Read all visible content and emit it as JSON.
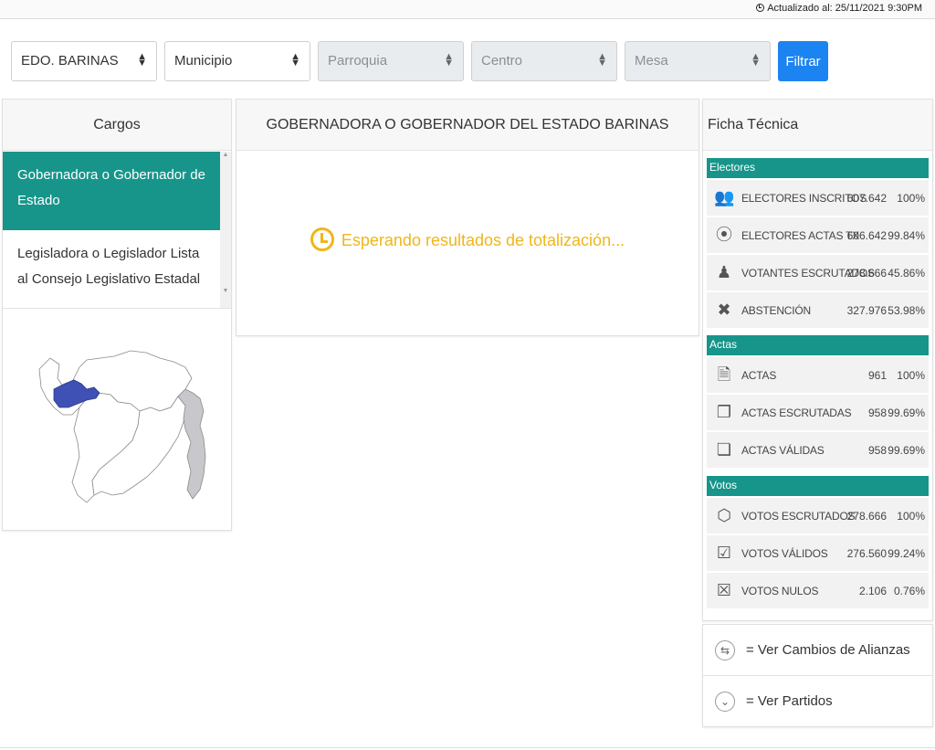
{
  "header": {
    "updated": "Actualizado al: 25/11/2021 9:30PM"
  },
  "filters": {
    "estado": "EDO. BARINAS",
    "municipio": "Municipio",
    "parroquia": "Parroquia",
    "centro": "Centro",
    "mesa": "Mesa",
    "button": "Filtrar"
  },
  "cargos": {
    "title": "Cargos",
    "items": [
      {
        "label": "Gobernadora o Gobernador de Estado",
        "active": true
      },
      {
        "label": "Legisladora o Legislador Lista al Consejo Legislativo Estadal",
        "active": false
      }
    ]
  },
  "main": {
    "title": "GOBERNADORA O GOBERNADOR DEL ESTADO BARINAS",
    "status": "Esperando resultados de totalización..."
  },
  "ficha": {
    "title": "Ficha Técnica",
    "electores": {
      "label": "Electores",
      "rows": [
        {
          "icon": "users-icon",
          "label": "ELECTORES INSCRITOS",
          "value": "607.642",
          "pct": "100%"
        },
        {
          "icon": "rss-icon",
          "label": "ELECTORES ACTAS TX",
          "value": "606.642",
          "pct": "99.84%"
        },
        {
          "icon": "user-plus-icon",
          "label": "VOTANTES ESCRUTADOS",
          "value": "278.666",
          "pct": "45.86%"
        },
        {
          "icon": "user-times-icon",
          "label": "ABSTENCIÓN",
          "value": "327.976",
          "pct": "53.98%"
        }
      ]
    },
    "actas": {
      "label": "Actas",
      "rows": [
        {
          "icon": "file-icon",
          "label": "ACTAS",
          "value": "961",
          "pct": "100%"
        },
        {
          "icon": "files-icon",
          "label": "ACTAS ESCRUTADAS",
          "value": "958",
          "pct": "99.69%"
        },
        {
          "icon": "file-copy-icon",
          "label": "ACTAS VÁLIDAS",
          "value": "958",
          "pct": "99.69%"
        }
      ]
    },
    "votos": {
      "label": "Votos",
      "rows": [
        {
          "icon": "ballot-box-icon",
          "label": "VOTOS ESCRUTADOS",
          "value": "278.666",
          "pct": "100%"
        },
        {
          "icon": "check-square-icon",
          "label": "VOTOS VÁLIDOS",
          "value": "276.560",
          "pct": "99.24%"
        },
        {
          "icon": "x-square-icon",
          "label": "VOTOS NULOS",
          "value": "2.106",
          "pct": "0.76%"
        }
      ]
    }
  },
  "legend": {
    "alianzas": "= Ver Cambios de Alianzas",
    "partidos": "= Ver Partidos"
  },
  "colors": {
    "accent": "#17958a",
    "primary": "#1b84f0",
    "warning": "#f0b619",
    "map_highlight": "#3f51b5",
    "map_gray": "#c8c8cc"
  }
}
